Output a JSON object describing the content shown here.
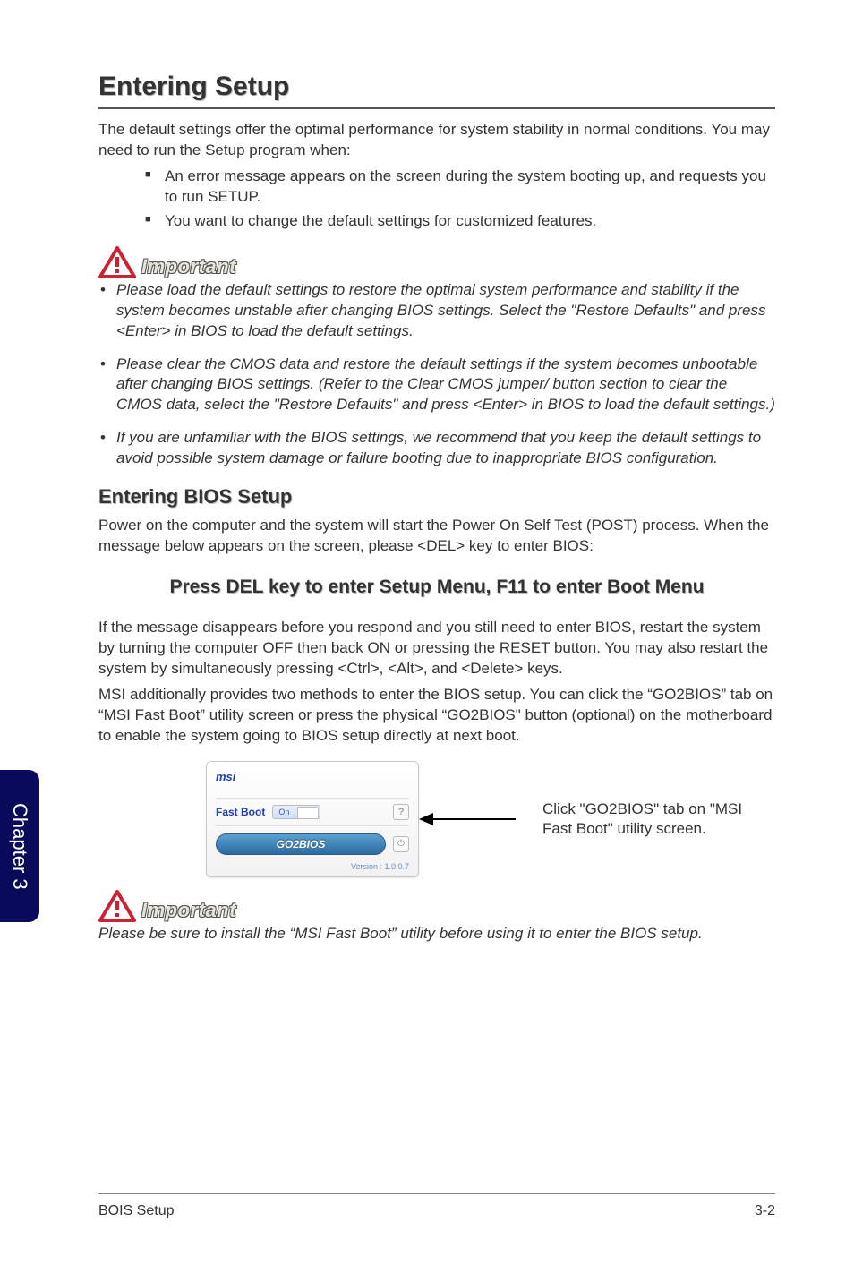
{
  "side_tab": "Chapter 3",
  "heading": "Entering Setup",
  "intro": "The default settings offer the optimal performance for system stability in normal conditions. You may need to run the Setup program when:",
  "intro_bullets": [
    "An error message appears on the screen during the system booting up, and requests you to run SETUP.",
    "You want to change the default settings for customized features."
  ],
  "important_label": "Important",
  "important_items": [
    "Please load the default settings to restore the optimal system performance and stability if the system becomes unstable after changing BIOS settings. Select the \"Restore Defaults\" and press <Enter> in BIOS to load the default settings.",
    "Please clear the CMOS data and restore the default settings if the system becomes unbootable after changing BIOS settings. (Refer to the Clear CMOS jumper/ button section to clear the CMOS data, select the \"Restore Defaults\" and press <Enter> in BIOS to load the default settings.)",
    "If you are unfamiliar with the BIOS settings, we recommend that you keep the default settings to avoid possible system damage or failure booting due to inappropriate BIOS configuration."
  ],
  "subheading": "Entering BIOS Setup",
  "post_para": "Power on the computer and the system will start the Power On Self Test (POST) process. When the message below appears on the screen, please <DEL> key to enter BIOS:",
  "press_line": "Press DEL key to enter Setup Menu, F11 to enter Boot Menu",
  "after_press_1": "If the message disappears before you respond and you still need to enter BIOS, restart the system by turning the computer OFF then back ON or pressing the RESET button. You may also restart the system by simultaneously pressing <Ctrl>, <Alt>, and <Delete> keys.",
  "after_press_2": "MSI additionally provides two methods to enter the BIOS setup. You can click the “GO2BIOS” tab on “MSI Fast Boot” utility screen or press the physical “GO2BIOS\" button (optional) on the motherboard to enable the system going to BIOS setup directly at next boot.",
  "fastboot": {
    "logo": "msi",
    "label": "Fast Boot",
    "toggle_state": "On",
    "help": "?",
    "go2_label": "GO2BIOS",
    "power": "⏻",
    "version": "Version : 1.0.0.7"
  },
  "figure_caption": "Click \"GO2BIOS\" tab on \"MSI Fast Boot\" utility screen.",
  "final_important": "Please be sure to install the “MSI Fast Boot” utility before using it to enter the BIOS setup.",
  "footer_left": "BOIS Setup",
  "footer_right": "3-2"
}
